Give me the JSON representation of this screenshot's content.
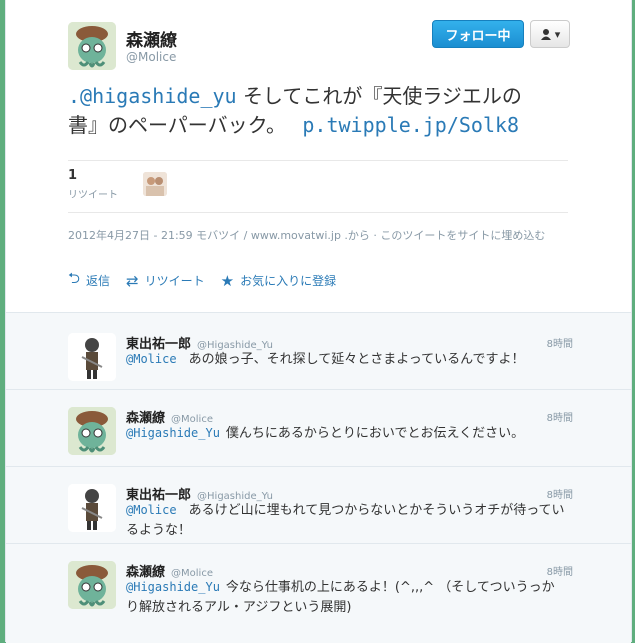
{
  "author": {
    "name": "森瀬繚",
    "handle": "@Molice"
  },
  "header": {
    "follow_label": "フォロー中",
    "user_menu_icon": "user-icon"
  },
  "tweet": {
    "mention": ".@higashide_yu",
    "text_part1": "そしてこれが『天使ラジエルの",
    "text_part2": "書』のペーパーバック。",
    "link": "p.twipple.jp/Solk8"
  },
  "stats": {
    "retweet_count": "1",
    "retweet_label": "リツイート"
  },
  "meta": {
    "text": "2012年4月27日 - 21:59 モバツイ / www.movatwi.jp .から · このツイートをサイトに埋め込む"
  },
  "actions": {
    "reply": "返信",
    "retweet": "リツイート",
    "favorite": "お気に入りに登録"
  },
  "replies": [
    {
      "name": "東出祐一郎",
      "handle": "@Higashide_Yu",
      "time": "8時間",
      "mention": "@Molice",
      "text": "あの娘っ子、それ探して延々とさまよっているんですよ！"
    },
    {
      "name": "森瀬繚",
      "handle": "@Molice",
      "time": "8時間",
      "mention": "@Higashide_Yu",
      "text": "僕んちにあるからとりにおいでとお伝えください。"
    },
    {
      "name": "東出祐一郎",
      "handle": "@Higashide_Yu",
      "time": "8時間",
      "mention": "@Molice",
      "text": "あるけど山に埋もれて見つからないとかそういうオチが待っているような！"
    },
    {
      "name": "森瀬繚",
      "handle": "@Molice",
      "time": "8時間",
      "mention": "@Higashide_Yu",
      "text": "今なら仕事机の上にあるよ！(^,,,^ （そしてついうっかり解放されるアル・アジフという展開)"
    }
  ]
}
